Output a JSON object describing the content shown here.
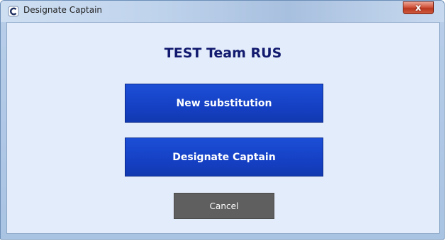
{
  "window": {
    "title": "Designate Captain",
    "close_glyph": "x",
    "app_icon": "app-icon"
  },
  "dialog": {
    "team_name": "TEST Team RUS",
    "new_substitution_label": "New substitution",
    "designate_captain_label": "Designate Captain",
    "cancel_label": "Cancel"
  },
  "colors": {
    "primary_button": "#1540c4",
    "cancel_button": "#5f5f5f",
    "title_text": "#111a6e",
    "client_background": "#e3ecfa",
    "close_button": "#d2553c"
  }
}
